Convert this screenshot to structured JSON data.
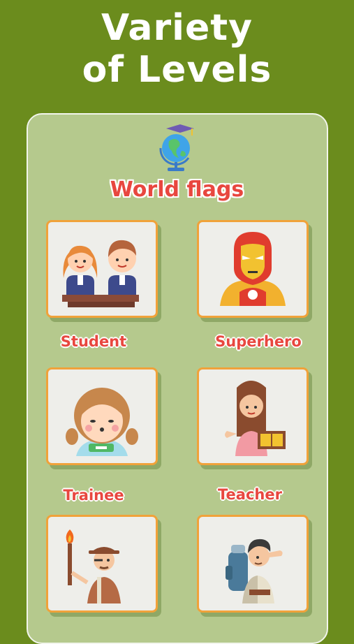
{
  "header": {
    "line1": "Variety",
    "line2": "of Levels"
  },
  "section": {
    "title": "World flags",
    "icon": "globe-icon"
  },
  "levels": [
    {
      "label": "Student",
      "icon": "students-icon"
    },
    {
      "label": "Superhero",
      "icon": "superhero-icon"
    },
    {
      "label": "Trainee",
      "icon": "trainee-icon"
    },
    {
      "label": "Teacher",
      "icon": "teacher-icon"
    },
    {
      "label": "",
      "icon": "explorer-icon"
    },
    {
      "label": "",
      "icon": "traveler-icon"
    }
  ],
  "colors": {
    "background": "#6b8c1d",
    "panel": "#b5c98d",
    "accent": "#e8473f",
    "card_border": "#f0a23a"
  }
}
